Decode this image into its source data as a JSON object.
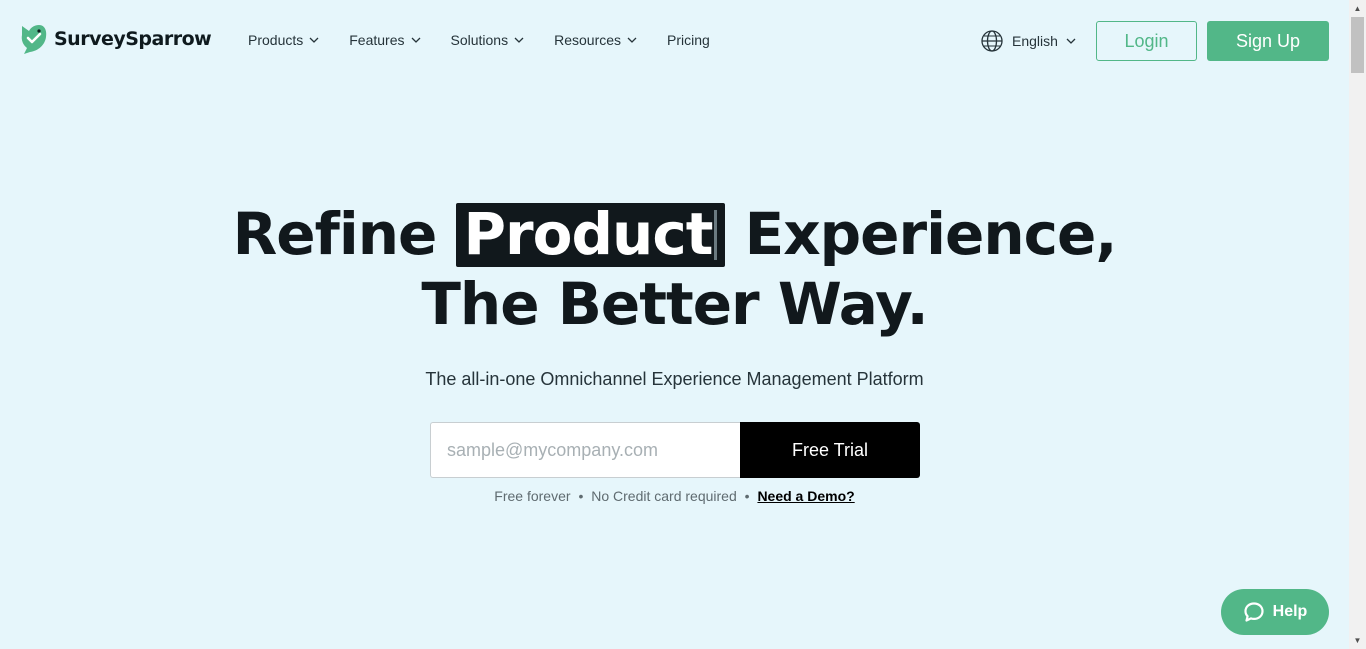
{
  "brand": {
    "name": "SurveySparrow",
    "accent_color": "#52b788",
    "background_color": "#e6f6fb",
    "dark_color": "#11181c"
  },
  "nav": {
    "items": [
      {
        "label": "Products",
        "has_dropdown": true
      },
      {
        "label": "Features",
        "has_dropdown": true
      },
      {
        "label": "Solutions",
        "has_dropdown": true
      },
      {
        "label": "Resources",
        "has_dropdown": true
      },
      {
        "label": "Pricing",
        "has_dropdown": false
      }
    ]
  },
  "header": {
    "language": "English",
    "login_label": "Login",
    "signup_label": "Sign Up"
  },
  "hero": {
    "headline_prefix": "Refine ",
    "headline_highlight": "Product",
    "headline_suffix": " Experience,",
    "headline_line2": "The Better Way.",
    "subtitle": "The all-in-one Omnichannel Experience Management Platform"
  },
  "signup_form": {
    "email_placeholder": "sample@mycompany.com",
    "email_value": "",
    "cta_label": "Free Trial"
  },
  "fine_print": {
    "item1": "Free forever",
    "item2": "No Credit card required",
    "separator": "•",
    "demo_link": "Need a Demo?"
  },
  "help": {
    "label": "Help"
  },
  "icons": {
    "logo": "sparrow-logo-icon",
    "dropdown": "chevron-down-icon",
    "language": "globe-icon",
    "help": "chat-bubble-icon"
  }
}
